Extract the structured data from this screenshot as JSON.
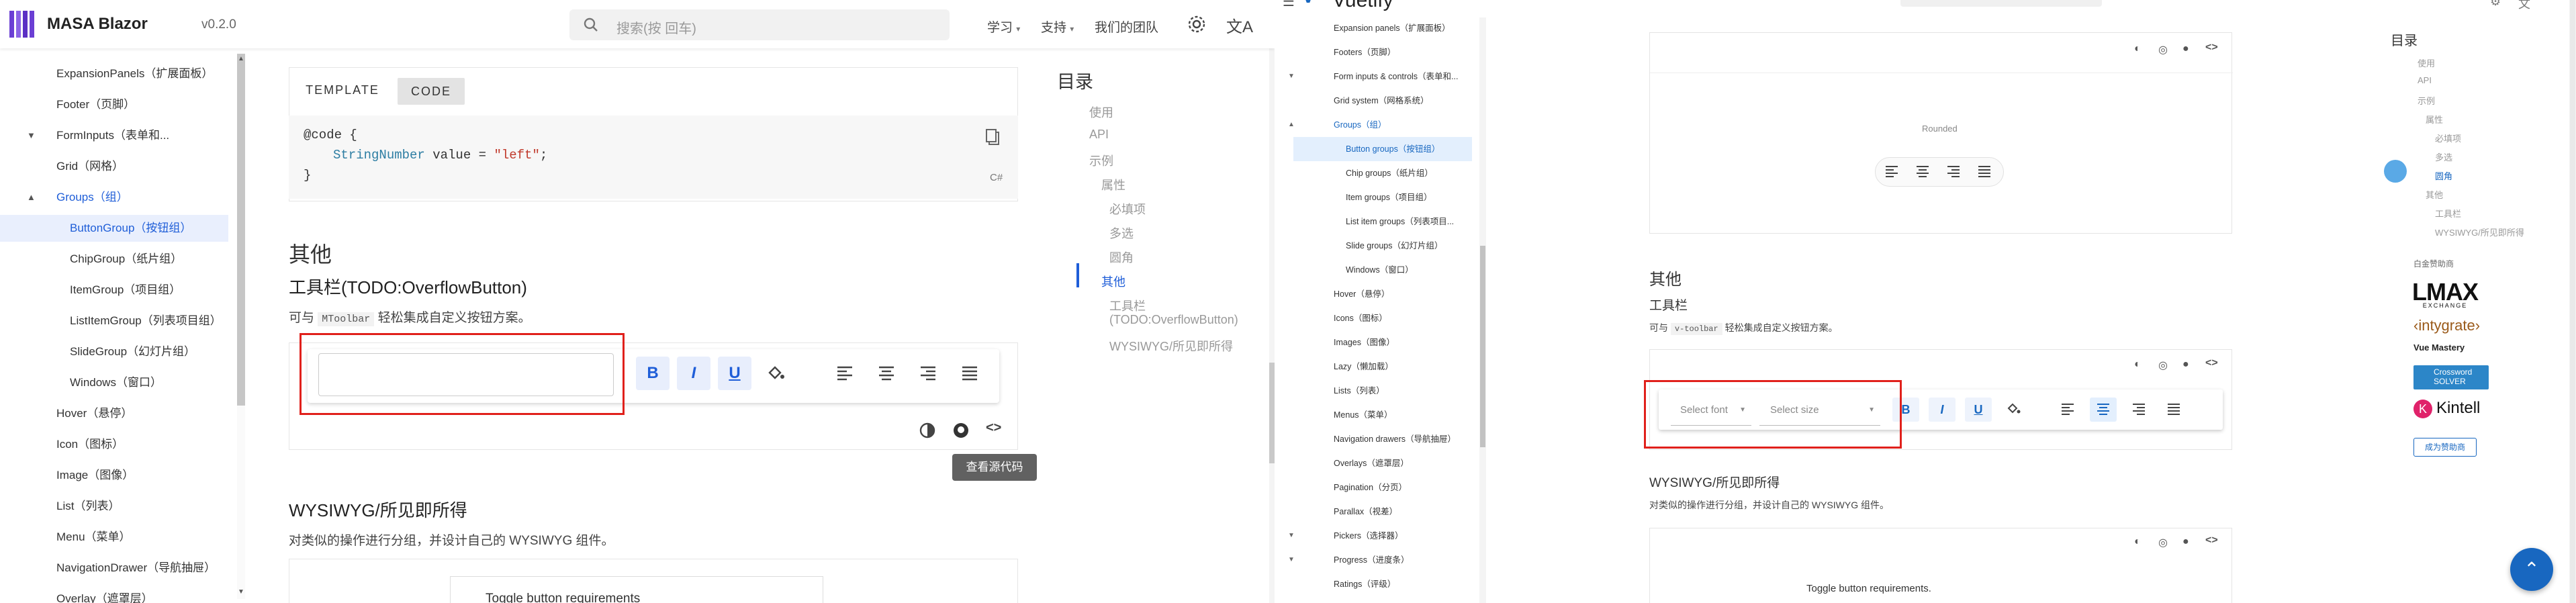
{
  "left": {
    "brand": "MASA Blazor",
    "version": "v0.2.0",
    "search_placeholder": "搜索(按 回车)",
    "nav": [
      {
        "label": "学习"
      },
      {
        "label": "支持"
      },
      {
        "label": "我们的团队"
      }
    ],
    "sidebar": [
      {
        "label": "ExpansionPanels（扩展面板）"
      },
      {
        "label": "Footer（页脚）"
      },
      {
        "label": "FormInputs（表单和..."
      },
      {
        "label": "Grid（网格）"
      },
      {
        "label": "Groups（组）"
      },
      {
        "label": "ButtonGroup（按钮组）"
      },
      {
        "label": "ChipGroup（纸片组）"
      },
      {
        "label": "ItemGroup（项目组）"
      },
      {
        "label": "ListItemGroup（列表项目组）"
      },
      {
        "label": "SlideGroup（幻灯片组）"
      },
      {
        "label": "Windows（窗口）"
      },
      {
        "label": "Hover（悬停）"
      },
      {
        "label": "Icon（图标）"
      },
      {
        "label": "Image（图像）"
      },
      {
        "label": "List（列表）"
      },
      {
        "label": "Menu（菜单）"
      },
      {
        "label": "NavigationDrawer（导航抽屉）"
      },
      {
        "label": "Overlay（遮罩层）"
      }
    ],
    "tabs": {
      "template": "TEMPLATE",
      "code": "CODE"
    },
    "code": {
      "line1": "@code {",
      "line2_type": "StringNumber",
      "line2_var": " value = ",
      "line2_str": "\"left\"",
      "line2_end": ";",
      "line3": "}",
      "lang": "C#"
    },
    "section_other": "其他",
    "toolbar_title": "工具栏(TODO:OverflowButton)",
    "toolbar_desc_pre": "可与",
    "toolbar_desc_code": "MToolbar",
    "toolbar_desc_post": "轻松集成自定义按钮方案。",
    "tooltip": "查看源代码",
    "wysiwyg_title": "WYSIWYG/所见即所得",
    "wysiwyg_desc": "对类似的操作进行分组，并设计自己的 WYSIWYG 组件。",
    "toggle_req": "Toggle button requirements",
    "toc": {
      "title": "目录",
      "items": [
        "使用",
        "API",
        "示例",
        "属性",
        "必填项",
        "多选",
        "圆角",
        "其他",
        "工具栏",
        "(TODO:OverflowButton)",
        "WYSIWYG/所见即所得"
      ]
    },
    "btn_labels": {
      "bold": "B",
      "italic": "I",
      "underline": "U"
    }
  },
  "right": {
    "title": "Vuetify",
    "sidebar": [
      {
        "label": "Expansion panels（扩展面板）"
      },
      {
        "label": "Footers（页脚）"
      },
      {
        "label": "Form inputs & controls（表单和..."
      },
      {
        "label": "Grid system（网格系统）"
      },
      {
        "label": "Groups（组）"
      },
      {
        "label": "Button groups（按钮组）"
      },
      {
        "label": "Chip groups（纸片组）"
      },
      {
        "label": "Item groups（项目组）"
      },
      {
        "label": "List item groups（列表项目..."
      },
      {
        "label": "Slide groups（幻灯片组）"
      },
      {
        "label": "Windows（窗口）"
      },
      {
        "label": "Hover（悬停）"
      },
      {
        "label": "Icons（图标）"
      },
      {
        "label": "Images（图像）"
      },
      {
        "label": "Lazy（懒加载）"
      },
      {
        "label": "Lists（列表）"
      },
      {
        "label": "Menus（菜单）"
      },
      {
        "label": "Navigation drawers（导航抽屉）"
      },
      {
        "label": "Overlays（遮罩层）"
      },
      {
        "label": "Pagination（分页）"
      },
      {
        "label": "Parallax（视差）"
      },
      {
        "label": "Pickers（选择器）"
      },
      {
        "label": "Progress（进度条）"
      },
      {
        "label": "Ratings（评级）"
      }
    ],
    "rounded_label": "Rounded",
    "section_other": "其他",
    "toolbar_title": "工具栏",
    "toolbar_desc_pre": "可与",
    "toolbar_desc_code": "v-toolbar",
    "toolbar_desc_post": "轻松集成自定义按钮方案。",
    "select_font": "Select font",
    "select_size": "Select size",
    "wysiwyg_title": "WYSIWYG/所见即所得",
    "wysiwyg_desc": "对类似的操作进行分组，并设计自己的 WYSIWYG 组件。",
    "toggle_req": "Toggle button requirements.",
    "toc": {
      "title": "目录",
      "items": [
        "使用",
        "API",
        "示例",
        "属性",
        "必填项",
        "多选",
        "圆角",
        "其他",
        "工具栏",
        "WYSIWYG/所见即所得"
      ]
    },
    "sponsors": {
      "label": "白金赞助商",
      "lmax": "LMAX",
      "lmax_sub": "EXCHANGE",
      "intygrate": "‹intygrate›",
      "vue_mastery": "Vue Mastery",
      "crossword": "Crossword SOLVER",
      "kintell": "Kintell",
      "become": "成为赞助商"
    },
    "btn_labels": {
      "bold": "B",
      "italic": "I",
      "underline": "U"
    }
  },
  "colors": {
    "accent": "#1f5ed8",
    "vuetify_accent": "#1867c0",
    "highlight_box": "#e0201b"
  }
}
